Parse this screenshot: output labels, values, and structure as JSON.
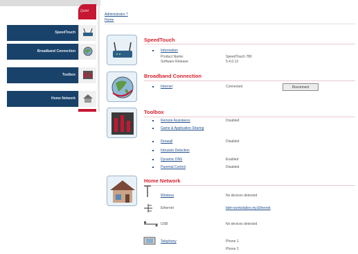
{
  "nav": {
    "logo_text": "Quint",
    "items": [
      {
        "label": "SpeedTouch",
        "icon": "router-icon"
      },
      {
        "label": "Broadband Connection",
        "icon": "globe-icon"
      },
      {
        "label": "Toolbox",
        "icon": "toolbox-icon"
      },
      {
        "label": "Home Network",
        "icon": "house-icon"
      }
    ]
  },
  "breadcrumb": {
    "parent": "Administrator ?",
    "current": "Home"
  },
  "sections": {
    "speedtouch": {
      "title": "SpeedTouch",
      "link": "Information",
      "product_label": "Product Name:",
      "product_value": "SpeedTouch 780",
      "software_label": "Software Release:",
      "software_value": "5.4.0.13"
    },
    "broadband": {
      "title": "Broadband Connection",
      "link": "Internet",
      "status": "Connected",
      "button": "Disconnect"
    },
    "toolbox": {
      "title": "Toolbox",
      "items": [
        {
          "label": "Remote Assistance",
          "value": "Disabled"
        },
        {
          "label": "Game & Application Sharing",
          "value": ""
        },
        {
          "label": "Firewall",
          "value": "Disabled"
        },
        {
          "label": "Intrusion Detection",
          "value": ""
        },
        {
          "label": "Dynamic DNS",
          "value": "Enabled"
        },
        {
          "label": "Parental Control",
          "value": "Disabled"
        }
      ]
    },
    "home_network": {
      "title": "Home Network",
      "devices": [
        {
          "label": "Wireless",
          "value": "No devices detected",
          "icon": "antenna-icon"
        },
        {
          "label": "Ethernet",
          "value": "bdm-workstation.my.Ethernet",
          "icon": "ethernet-icon"
        },
        {
          "label": "USB",
          "value": "No devices detected",
          "icon": "usb-icon"
        },
        {
          "label": "Telephony",
          "value": "Phone 1",
          "value2": "Phone 2",
          "icon": "phone-icon"
        }
      ]
    }
  },
  "colors": {
    "nav_blue": "#19426a",
    "accent_red": "#c71632",
    "title_red": "#d6202f",
    "link_blue": "#1f4f8c"
  }
}
